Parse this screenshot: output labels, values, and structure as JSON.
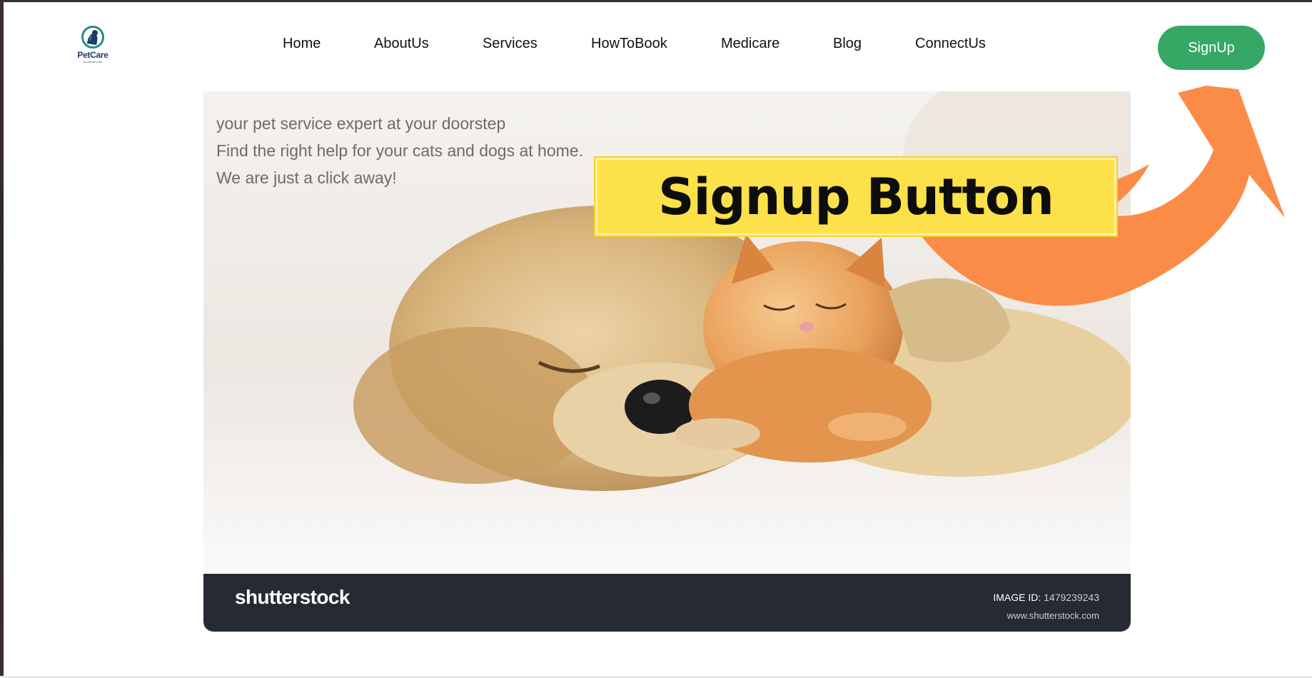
{
  "brand": {
    "name": "PetCare",
    "tagline": "DOORSTEP CARE",
    "icon": "dog-cat-logo-icon"
  },
  "nav": {
    "items": [
      {
        "label": "Home"
      },
      {
        "label": "AboutUs"
      },
      {
        "label": "Services"
      },
      {
        "label": "HowToBook"
      },
      {
        "label": "Medicare"
      },
      {
        "label": "Blog"
      },
      {
        "label": "ConnectUs"
      }
    ],
    "signup_label": "SignUp"
  },
  "hero": {
    "lines": [
      "your pet service expert at your doorstep",
      "Find the right help for your cats and dogs at home.",
      "We are just a click away!"
    ],
    "image_alt_subject": "puppy and kitten sleeping"
  },
  "stock_watermark": {
    "logo": "shutterstock",
    "image_id_label": "IMAGE ID:",
    "image_id_value": "1479239243",
    "url": "www.shutterstock.com"
  },
  "annotation": {
    "label": "Signup Button",
    "arrow_icon": "curved-arrow-icon"
  },
  "colors": {
    "signup_button": "#35a866",
    "callout_fill": "#fde14a",
    "arrow": "#fb8c47",
    "stock_bar": "#262a33",
    "brand_text": "#1d3b6b"
  }
}
